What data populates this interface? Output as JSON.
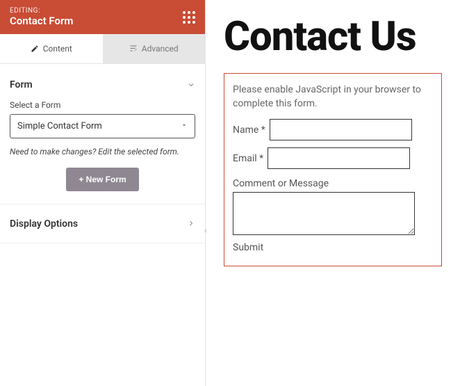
{
  "header": {
    "label": "EDITING:",
    "title": "Contact Form"
  },
  "tabs": {
    "content": "Content",
    "advanced": "Advanced"
  },
  "form_section": {
    "title": "Form",
    "select_label": "Select a Form",
    "select_value": "Simple Contact Form",
    "help": "Need to make changes? Edit the selected form.",
    "new_button": "+ New Form"
  },
  "display_section": {
    "title": "Display Options"
  },
  "preview": {
    "heading": "Contact Us",
    "js_message": "Please enable JavaScript in your browser to complete this form.",
    "name_label": "Name *",
    "email_label": "Email *",
    "comment_label": "Comment or Message",
    "submit": "Submit"
  }
}
